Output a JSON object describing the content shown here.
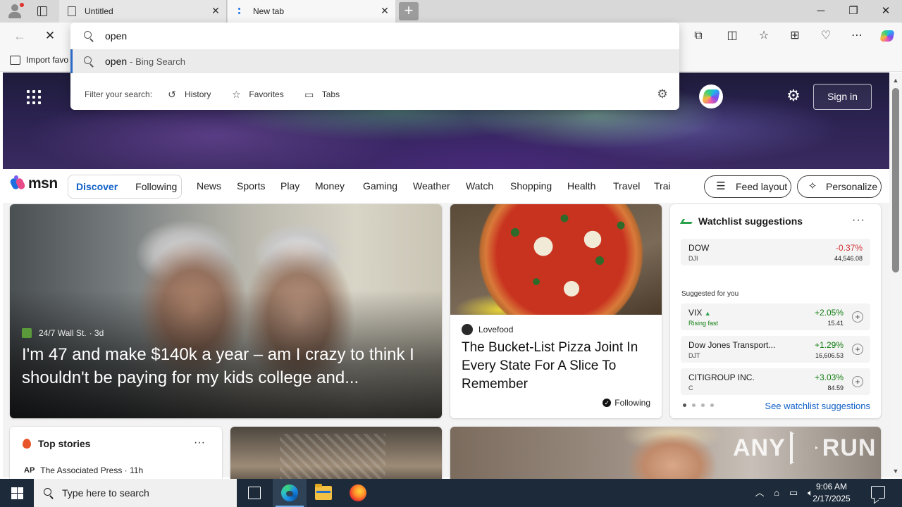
{
  "tabs": [
    {
      "title": "Untitled",
      "close": "✕"
    },
    {
      "title": "New tab",
      "close": "✕"
    }
  ],
  "new_tab_symbol": "+",
  "window_controls": {
    "minimize": "─",
    "restore": "❐",
    "close": "✕"
  },
  "toolbar": {
    "back": "←",
    "stop": "✕",
    "icons": [
      "extensions-icon",
      "split-screen-icon",
      "favorites-icon",
      "collections-icon",
      "browser-essentials-icon",
      "settings-more-icon"
    ],
    "more": "⋯"
  },
  "favorites_bar": {
    "import_label": "Import favo"
  },
  "omnibox": {
    "query": "open",
    "suggestion": {
      "query": "open",
      "source": "- Bing Search"
    },
    "filter_label": "Filter your search:",
    "filters": [
      "History",
      "Favorites",
      "Tabs"
    ]
  },
  "header": {
    "sign_in": "Sign in"
  },
  "msn": {
    "logo_text": "msn",
    "segment": {
      "active": "Discover",
      "inactive": "Following"
    },
    "nav": [
      "News",
      "Sports",
      "Play",
      "Money",
      "Gaming",
      "Weather",
      "Watch",
      "Shopping",
      "Health",
      "Travel",
      "Trai"
    ],
    "feed_layout": "Feed layout",
    "personalize": "Personalize"
  },
  "hero_article": {
    "source": "24/7 Wall St.",
    "age": "· 3d",
    "title": "I'm 47 and make $140k a year – am I crazy to think I shouldn't be paying for my kids college and..."
  },
  "pizza_article": {
    "source": "Lovefood",
    "title": "The Bucket-List Pizza Joint In Every State For A Slice To Remember",
    "following": "Following"
  },
  "watchlist": {
    "title": "Watchlist suggestions",
    "more": "···",
    "primary": {
      "name": "DOW",
      "ticker": "DJI",
      "change": "-0.37%",
      "price": "44,546.08"
    },
    "suggested_label": "Suggested for you",
    "suggested": [
      {
        "name": "VIX",
        "sub": "Rising fast",
        "change": "+2.05%",
        "price": "15.41"
      },
      {
        "name": "Dow Jones Transport...",
        "sub": "DJT",
        "change": "+1.29%",
        "price": "16,606.53"
      },
      {
        "name": "CITIGROUP INC.",
        "sub": "C",
        "change": "+3.03%",
        "price": "84.59"
      }
    ],
    "see_more": "See watchlist suggestions",
    "colors": {
      "negative": "#d13438",
      "positive": "#107c10"
    }
  },
  "top_stories": {
    "title": "Top stories",
    "more": "···",
    "first_source": "The Associated Press · 11h",
    "first_source_logo": "AP"
  },
  "watermark": {
    "left": "ANY",
    "right": "RUN"
  },
  "taskbar": {
    "search_placeholder": "Type here to search",
    "time": "9:06 AM",
    "date": "2/17/2025"
  }
}
